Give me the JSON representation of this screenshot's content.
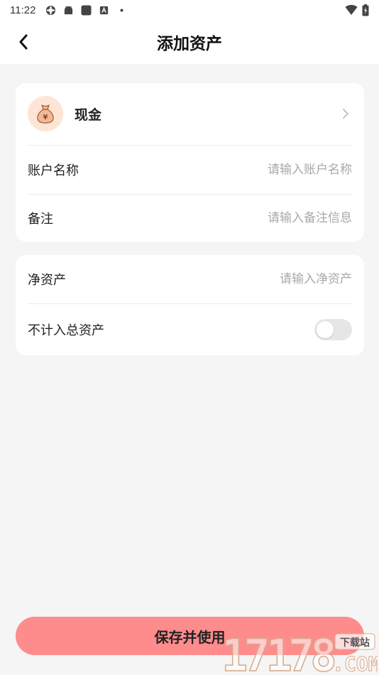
{
  "status_bar": {
    "time": "11:22"
  },
  "header": {
    "title": "添加资产"
  },
  "asset": {
    "name": "现金",
    "icon": "money-bag-icon",
    "icon_bg": "#fde5d6"
  },
  "form": {
    "account_name_label": "账户名称",
    "account_name_placeholder": "请输入账户名称",
    "account_name_value": "",
    "note_label": "备注",
    "note_placeholder": "请输入备注信息",
    "note_value": "",
    "net_asset_label": "净资产",
    "net_asset_placeholder": "请输入净资产",
    "net_asset_value": "",
    "exclude_total_label": "不计入总资产",
    "exclude_total_on": false
  },
  "save_button": {
    "label": "保存并使用",
    "color": "#ff8c8c"
  },
  "watermark": {
    "brand": "17178",
    "tag": "下载站",
    "domain": ".COM"
  }
}
